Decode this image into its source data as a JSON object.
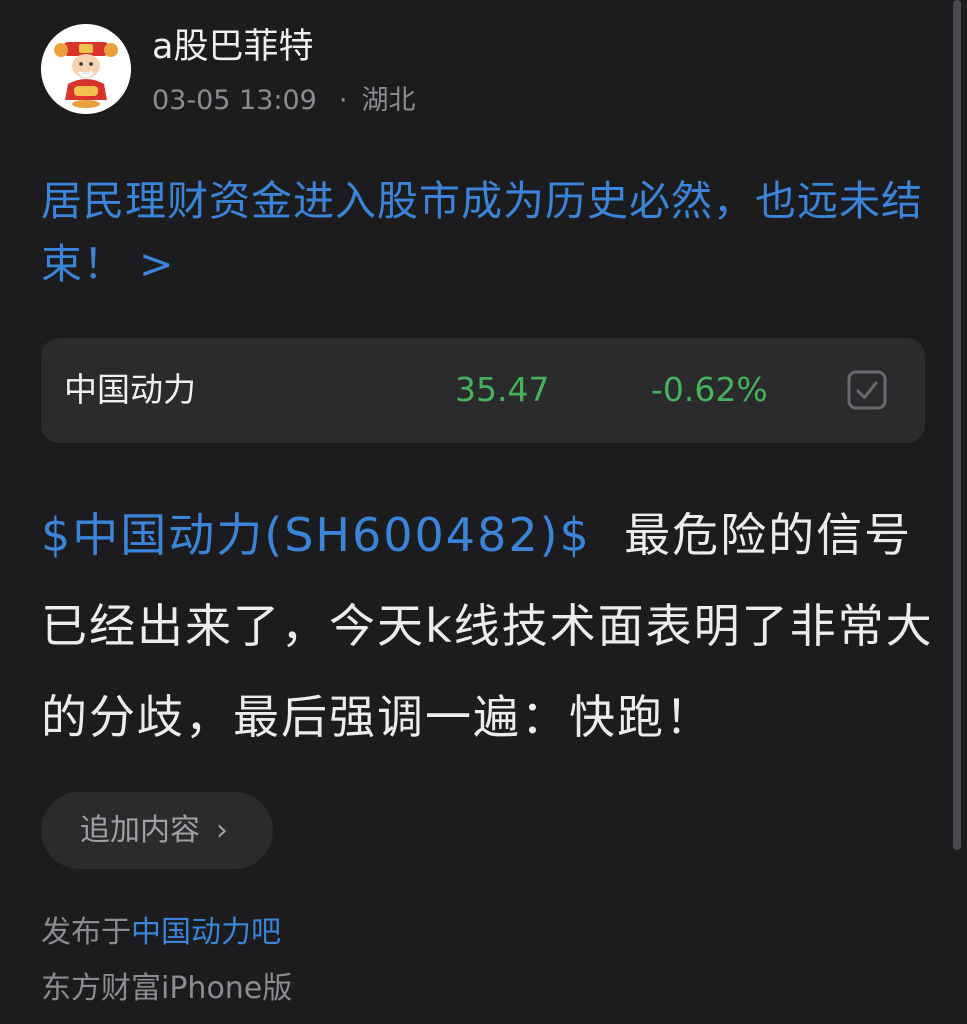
{
  "author": {
    "name": "a股巴菲特",
    "avatar_icon": "god-of-wealth-avatar",
    "date": "03-05 13:09",
    "separator": "·",
    "location": "湖北"
  },
  "post": {
    "title": "居民理财资金进入股市成为历史必然，也远未结束！ >",
    "stock_tag": "$中国动力(SH600482)$",
    "body": "最危险的信号已经出来了，今天k线技术面表明了非常大的分歧，最后强调一遍：快跑！"
  },
  "stock_card": {
    "name": "中国动力",
    "price": "35.47",
    "change": "-0.62%",
    "change_color": "#45b25c",
    "action_icon": "checkbox-checked-icon"
  },
  "append_button": {
    "label": "追加内容",
    "icon": "chevron-right-icon",
    "icon_glyph": "›"
  },
  "footer": {
    "published_prefix": "发布于",
    "forum_name": "中国动力吧",
    "source": "东方财富iPhone版"
  },
  "colors": {
    "background": "#1c1c1e",
    "link": "#3a84d9",
    "down_green": "#45b25c",
    "card": "#2b2b2e"
  }
}
